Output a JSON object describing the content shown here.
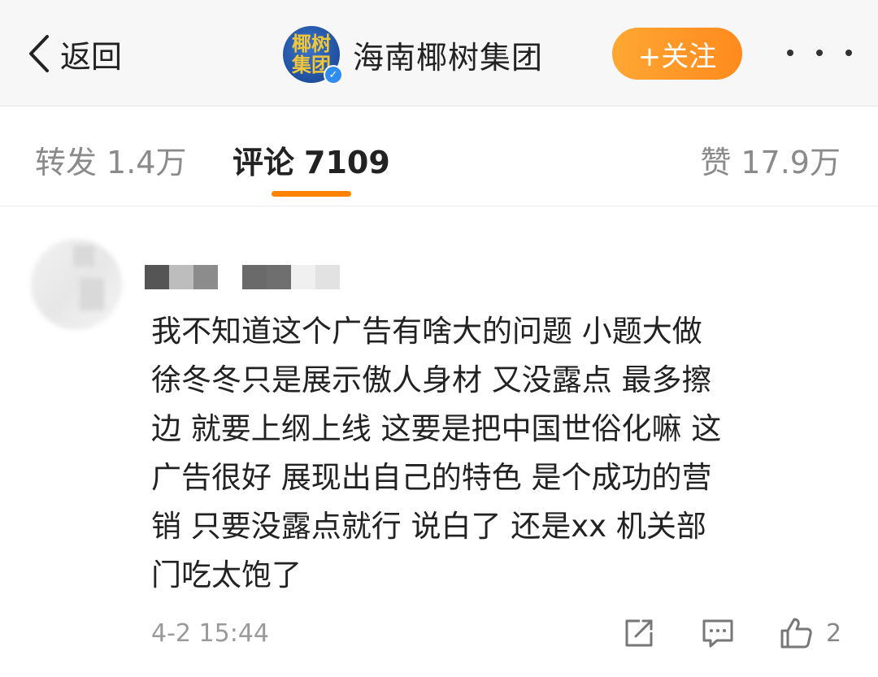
{
  "header": {
    "back_label": "返回",
    "account_name": "海南椰树集团",
    "avatar_text": "椰树集团",
    "follow_label": "+关注"
  },
  "tabs": [
    {
      "label": "转发",
      "count": "1.4万"
    },
    {
      "label": "评论",
      "count": "7109"
    },
    {
      "label": "赞",
      "count": "17.9万"
    }
  ],
  "comment": {
    "text": "我不知道这个广告有啥大的问题  小题大做\n徐冬冬只是展示傲人身材  又没露点 最多擦\n边 就要上纲上线  这要是把中国世俗化嘛  这\n广告很好 展现出自己的特色 是个成功的营\n销 只要没露点就行  说白了  还是xx 机关部\n门吃太饱了",
    "time": "4-2 15:44",
    "like_count": "2"
  },
  "colors": {
    "accent": "#ff8200",
    "follow_button": "#ff9a2a",
    "header_bg": "#f7f7f7",
    "muted_text": "#8a8a8a"
  }
}
